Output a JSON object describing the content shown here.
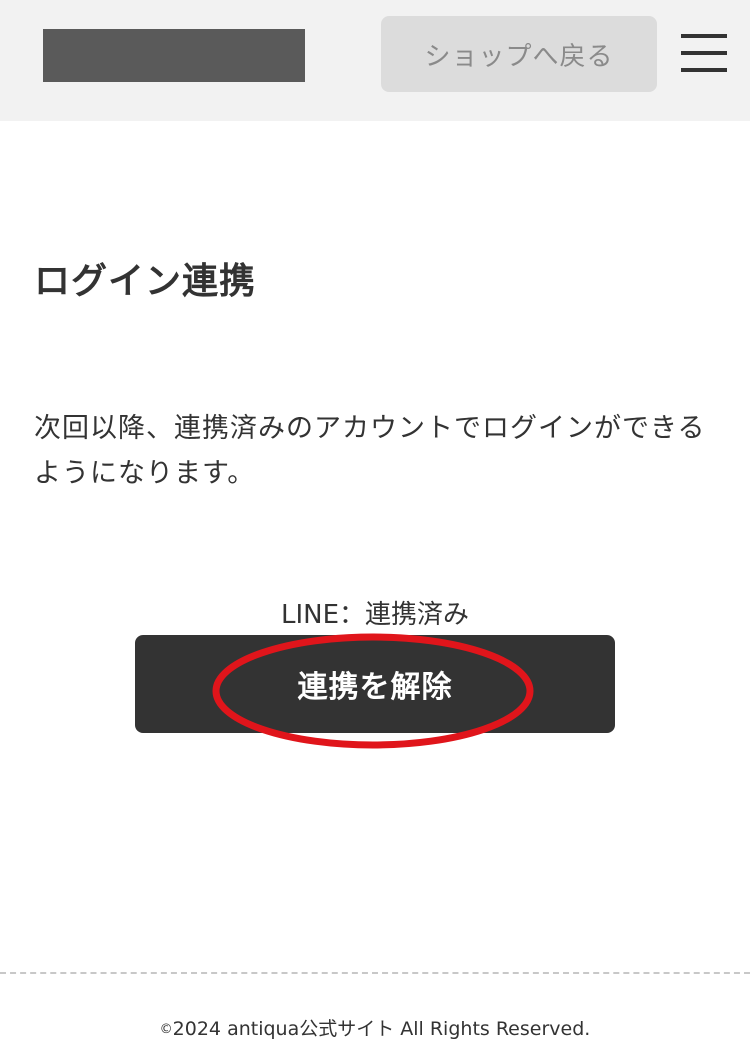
{
  "header": {
    "back_button_label": "ショップへ戻る",
    "menu_icon": "hamburger-menu-icon"
  },
  "main": {
    "title": "ログイン連携",
    "description": "次回以降、連携済みのアカウントでログインができるようになります。",
    "status": {
      "provider": "LINE",
      "separator": "：",
      "value": "連携済み"
    },
    "unlink_button_label": "連携を解除"
  },
  "footer": {
    "copyright_mark": "©",
    "copyright_text": "2024 antiqua公式サイト All Rights Reserved."
  },
  "colors": {
    "header_bg": "#f2f2f2",
    "button_dark": "#333333",
    "highlight_red": "#e0151b"
  }
}
